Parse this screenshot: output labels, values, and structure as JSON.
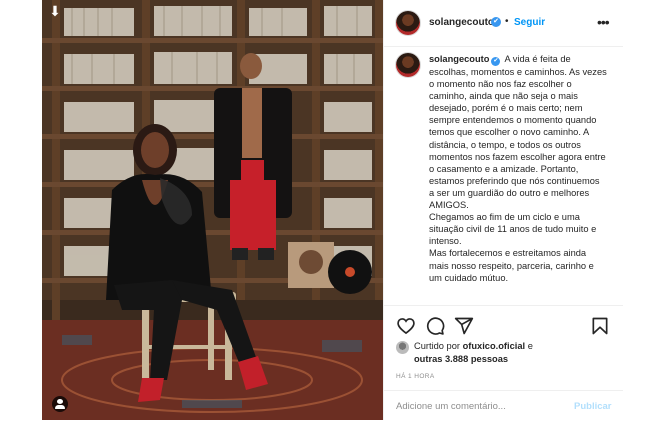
{
  "post": {
    "download_icon": "download-arrow-icon",
    "tag_icon": "user-tag-icon",
    "header": {
      "username": "solangecouto",
      "verified_badge": "✔",
      "separator": "•",
      "follow_label": "Seguir",
      "more_icon": "ellipsis-icon"
    },
    "caption": {
      "username": "solangecouto",
      "paragraphs": [
        "A vida é feita de escolhas, momentos e caminhos. As vezes o momento não nos faz escolher o caminho, ainda que não seja o mais desejado, porém é o mais certo; nem sempre entendemos o momento quando temos que escolher o novo caminho. A distância, o tempo, e todos os outros momentos nos fazem escolher agora entre o casamento e a amizade. Portanto, estamos preferindo que nós continuemos a ser um guardião do outro e melhores AMIGOS.",
        "Chegamos ao fim de um ciclo e uma situação civil de 11 anos de tudo muito e intenso.",
        "Mas fortalecemos e estreitamos ainda mais nosso respeito, parceria, carinho e um cuidado mútuo."
      ]
    },
    "actions": {
      "icons": [
        "heart-icon",
        "comment-icon",
        "share-icon",
        "save-icon"
      ]
    },
    "likes": {
      "prefix": "Curtido por",
      "liked_by": "ofuxico.oficial",
      "connector": "e",
      "others": "outras 3.888 pessoas"
    },
    "timestamp": "HÁ 1 HORA",
    "comment": {
      "placeholder": "Adicione um comentário...",
      "publish_label": "Publicar"
    },
    "colors": {
      "accent": "#0095f6",
      "verified": "#3897f0",
      "publish_disabled": "#b2dffc",
      "muted": "#8e8e8e"
    }
  }
}
